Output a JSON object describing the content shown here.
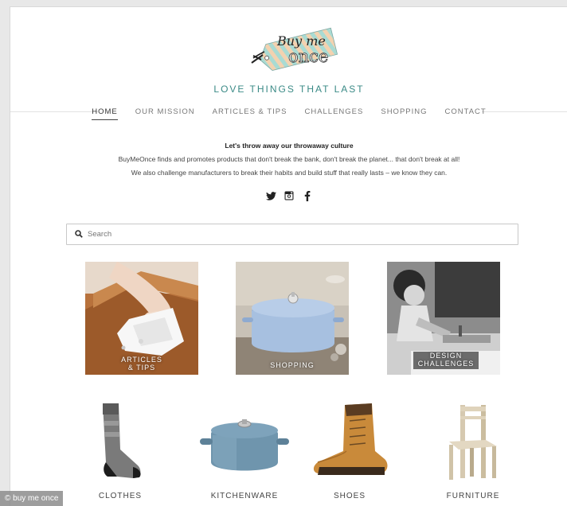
{
  "brand": {
    "logo_line1": "Buy me",
    "logo_line2": "once",
    "tagline": "LOVE THINGS THAT LAST"
  },
  "nav": {
    "items": [
      {
        "label": "HOME",
        "active": true
      },
      {
        "label": "OUR MISSION",
        "active": false
      },
      {
        "label": "ARTICLES & TIPS",
        "active": false
      },
      {
        "label": "CHALLENGES",
        "active": false
      },
      {
        "label": "SHOPPING",
        "active": false
      },
      {
        "label": "CONTACT",
        "active": false
      }
    ]
  },
  "intro": {
    "heading": "Let's throw away our throwaway culture",
    "line1": "BuyMeOnce finds and promotes products that don't break the bank, don't break the planet... that don't break at all!",
    "line2": "We also challenge manufacturers to break their habits and build stuff that really lasts – we know they can."
  },
  "social": {
    "icons": [
      "twitter-icon",
      "instagram-icon",
      "facebook-icon"
    ]
  },
  "search": {
    "placeholder": "Search",
    "icon": "search-icon"
  },
  "tiles": {
    "articles": "ARTICLES & TIPS",
    "shopping": "SHOPPING",
    "design": "DESIGN CHALLENGES"
  },
  "products": {
    "clothes": "CLOTHES",
    "kitchenware": "KITCHENWARE",
    "shoes": "SHOES",
    "furniture": "FURNITURE"
  },
  "watermark": "© buy me once",
  "colors": {
    "accent": "#3a8a86",
    "tag_mint": "#a9dbd3",
    "tag_peach": "#f3d2b0"
  }
}
